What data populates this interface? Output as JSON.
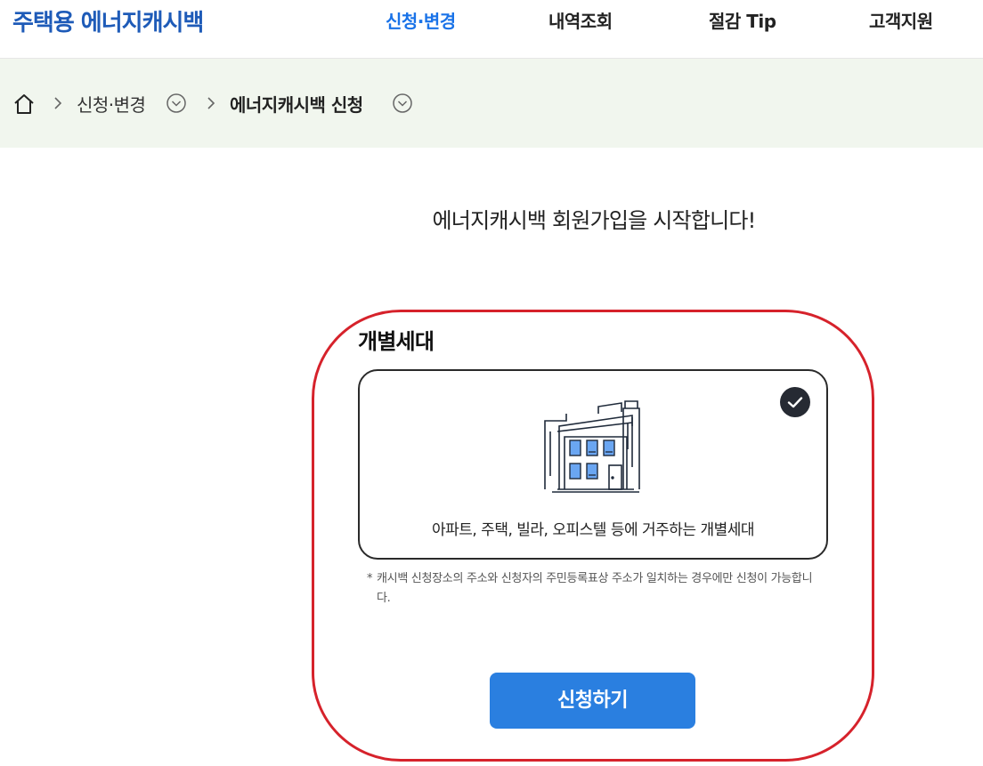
{
  "header": {
    "logo": "주택용 에너지캐시백",
    "nav": [
      {
        "label": "신청·변경",
        "active": true
      },
      {
        "label": "내역조회",
        "active": false
      },
      {
        "label": "절감 Tip",
        "active": false
      },
      {
        "label": "고객지원",
        "active": false
      }
    ]
  },
  "breadcrumb": {
    "home_icon": "home-icon",
    "items": [
      {
        "label": "신청·변경"
      },
      {
        "label": "에너지캐시백 신청"
      }
    ]
  },
  "main": {
    "title": "에너지캐시백 회원가입을 시작합니다!",
    "section_title": "개별세대",
    "option": {
      "icon": "building-icon",
      "selected": true,
      "label": "아파트, 주택, 빌라, 오피스텔 등에 거주하는 개별세대"
    },
    "note_star": "*",
    "note": "캐시백 신청장소의 주소와 신청자의 주민등록표상 주소가 일치하는 경우에만 신청이 가능합니다.",
    "submit_label": "신청하기"
  },
  "colors": {
    "brand": "#1e5bb8",
    "accent": "#1a73e8",
    "button": "#2a7fe0",
    "breadcrumb_bg": "#f1f6ee",
    "highlight": "#d6222b"
  }
}
